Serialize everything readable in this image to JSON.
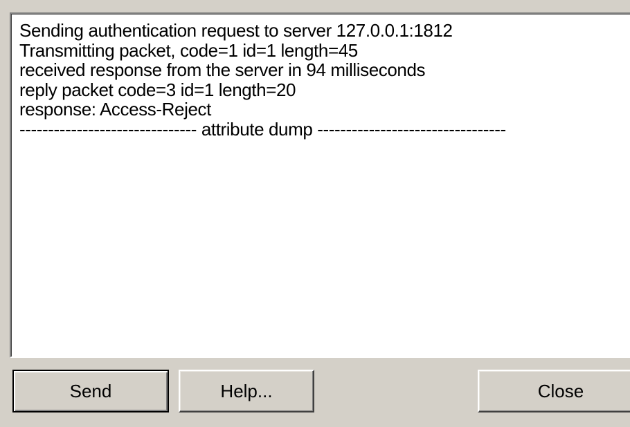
{
  "log": {
    "lines": [
      "Sending authentication request to server 127.0.0.1:1812",
      "Transmitting packet, code=1 id=1 length=45",
      "received response from the server in 94 milliseconds",
      "reply packet code=3 id=1 length=20",
      "response: Access-Reject",
      "------------------------------- attribute dump ---------------------------------"
    ]
  },
  "buttons": {
    "send": "Send",
    "help": "Help...",
    "close": "Close"
  }
}
